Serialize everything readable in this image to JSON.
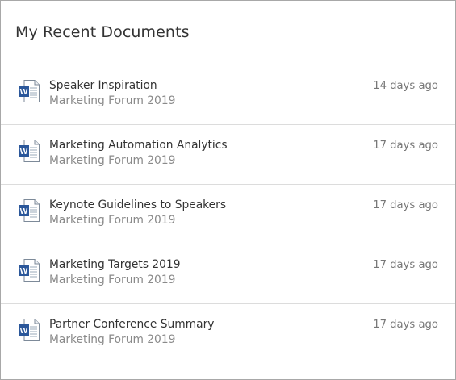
{
  "panel": {
    "title": "My Recent Documents"
  },
  "colors": {
    "word_blue": "#2b579a",
    "divider": "#dcdcdc",
    "border": "#a8a8a8",
    "secondary_text": "#8a8a8a"
  },
  "documents": [
    {
      "icon": "word-document-icon",
      "title": "Speaker Inspiration",
      "subtitle": "Marketing Forum 2019",
      "time": "14 days ago"
    },
    {
      "icon": "word-document-icon",
      "title": "Marketing Automation Analytics",
      "subtitle": "Marketing Forum 2019",
      "time": "17 days ago"
    },
    {
      "icon": "word-document-icon",
      "title": "Keynote Guidelines to Speakers",
      "subtitle": "Marketing Forum 2019",
      "time": "17 days ago"
    },
    {
      "icon": "word-document-icon",
      "title": "Marketing Targets 2019",
      "subtitle": "Marketing Forum 2019",
      "time": "17 days ago"
    },
    {
      "icon": "word-document-icon",
      "title": "Partner Conference Summary",
      "subtitle": "Marketing Forum 2019",
      "time": "17 days ago"
    }
  ]
}
